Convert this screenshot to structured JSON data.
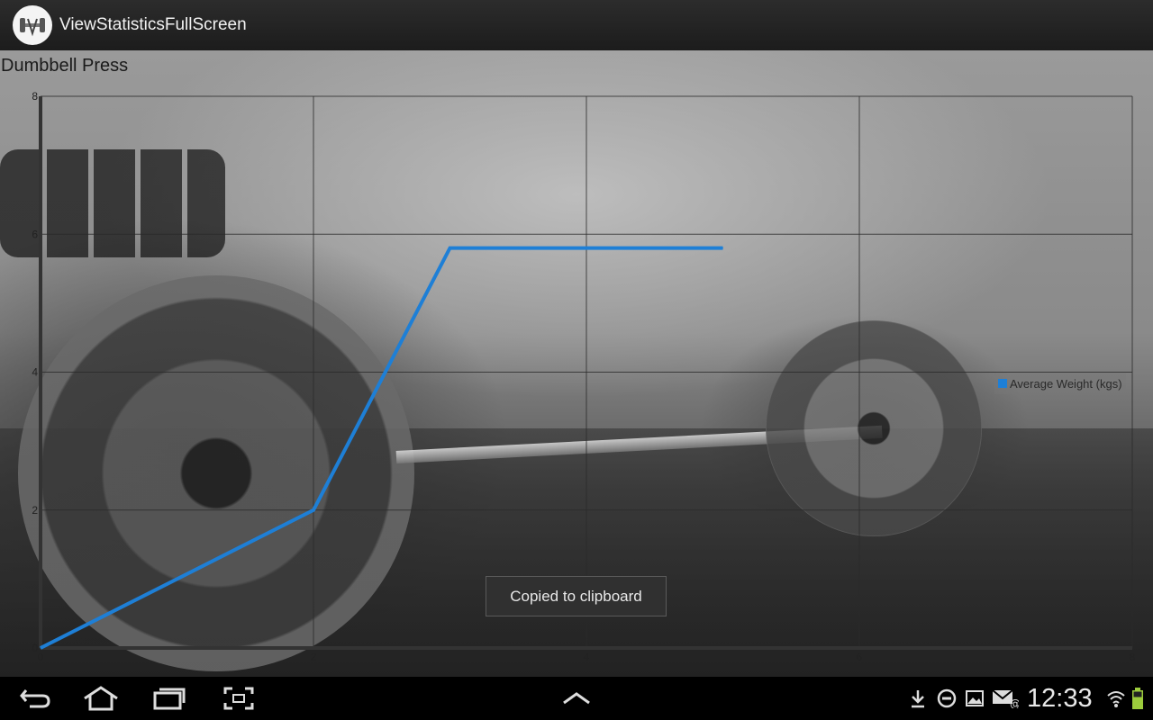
{
  "app": {
    "title": "ViewStatisticsFullScreen"
  },
  "screen": {
    "chart_title": "Dumbbell Press",
    "toast": "Copied to clipboard"
  },
  "chart_data": {
    "type": "line",
    "title": "Dumbbell Press",
    "xlabel": "",
    "ylabel": "",
    "xlim": [
      0,
      8
    ],
    "ylim": [
      0,
      8
    ],
    "xticks": [
      0,
      2,
      4,
      6,
      8
    ],
    "yticks": [
      0,
      2,
      4,
      6,
      8
    ],
    "grid": true,
    "legend": "right",
    "series": [
      {
        "name": "Average Weight (kgs)",
        "color": "#1e7fd6",
        "x": [
          0,
          2,
          3,
          5
        ],
        "y": [
          0,
          2,
          5.8,
          5.8
        ]
      }
    ]
  },
  "system_bar": {
    "time": "12:33",
    "nav_icons": [
      "back-icon",
      "home-icon",
      "recent-apps-icon",
      "screenshot-icon",
      "menu-up-icon"
    ],
    "status_icons": [
      "download-icon",
      "do-not-disturb-icon",
      "image-icon",
      "email-icon",
      "wifi-icon",
      "battery-icon"
    ]
  }
}
